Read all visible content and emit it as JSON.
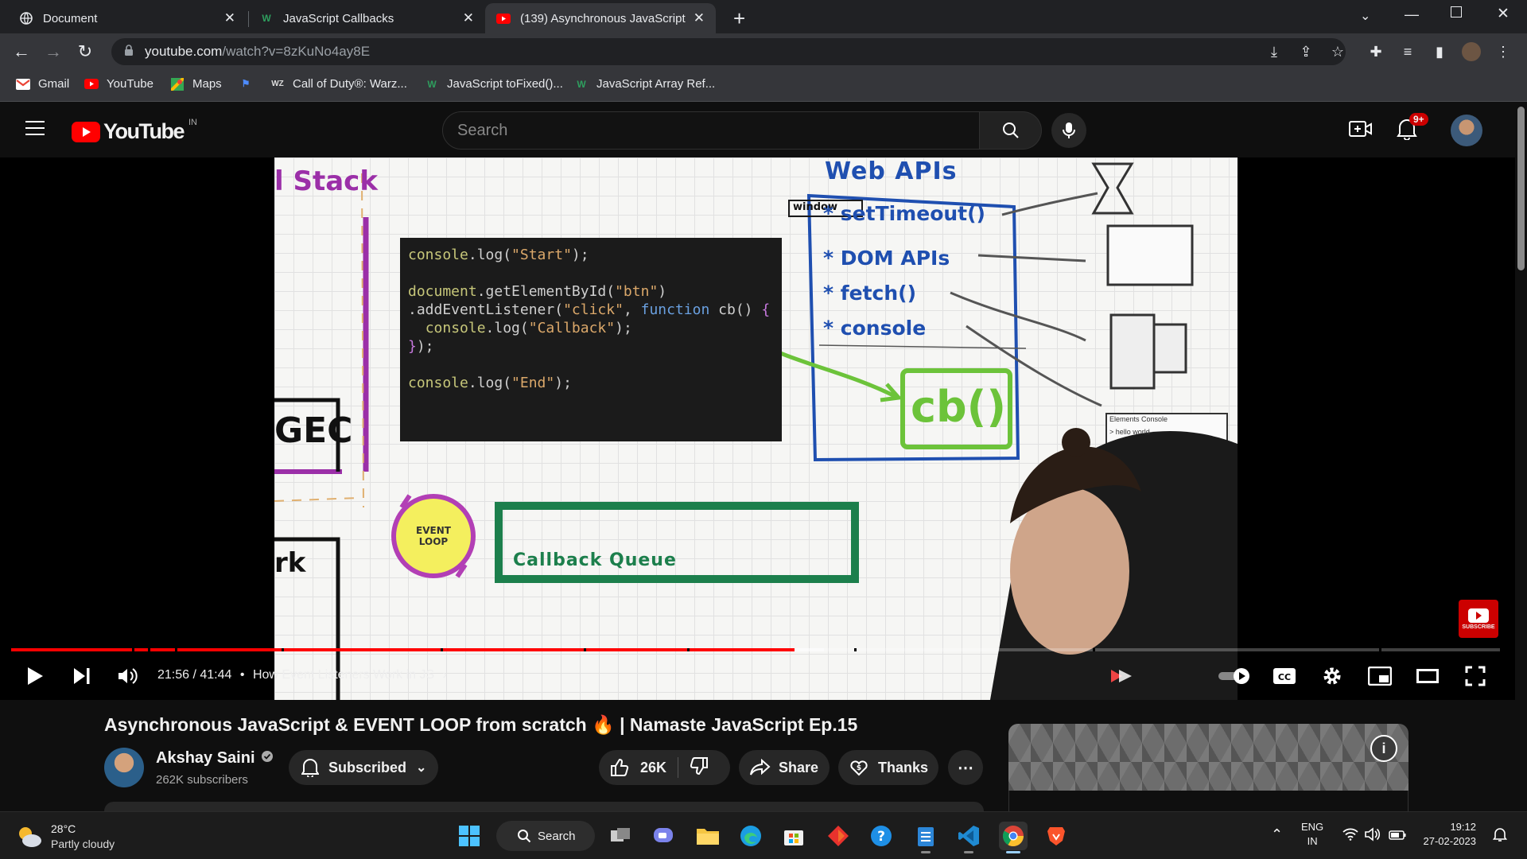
{
  "browser": {
    "tabs": [
      {
        "title": "Document",
        "active": false
      },
      {
        "title": "JavaScript Callbacks",
        "active": false
      },
      {
        "title": "(139) Asynchronous JavaScript &",
        "active": true
      }
    ],
    "url_host": "youtube.com",
    "url_path": "/watch?v=8zKuNo4ay8E",
    "bookmarks": [
      "Gmail",
      "YouTube",
      "Maps",
      "Call of Duty®: Warz...",
      "JavaScript toFixed()...",
      "JavaScript Array Ref..."
    ]
  },
  "youtube": {
    "logo_text": "YouTube",
    "region": "IN",
    "search_placeholder": "Search",
    "notifications": "9+"
  },
  "video_frame": {
    "call_stack_label": "l Stack",
    "gec_label": "GEC",
    "task_label": "rk",
    "code_lines": [
      "console.log(\"Start\");",
      "",
      "document.getElementById(\"btn\")",
      ".addEventListener(\"click\", function cb() {",
      "  console.log(\"Callback\");",
      "});",
      "",
      "console.log(\"End\");"
    ],
    "web_apis_title": "Web APIs",
    "window_label": "window",
    "web_apis": [
      "* setTimeout()",
      "* DOM APIs",
      "* fetch()",
      "* console"
    ],
    "cb_label": "cb()",
    "event_loop_label": "EVENT LOOP",
    "callback_queue_label": "Callback Queue",
    "devtools_tabs": "Elements   Console",
    "devtools_output": "> hello world",
    "subscribe_watermark": "SUBSCRIBE"
  },
  "player": {
    "time": "21:56 / 41:44",
    "chapter": "How Event Listeners Work in JS",
    "progress_fraction": 0.526
  },
  "video": {
    "title": "Asynchronous JavaScript & EVENT LOOP from scratch 🔥 | Namaste JavaScript Ep.15",
    "channel": "Akshay Saini",
    "subscribers": "262K subscribers",
    "subscribe_label": "Subscribed",
    "likes": "26K",
    "share_label": "Share",
    "thanks_label": "Thanks"
  },
  "taskbar": {
    "weather_temp": "28°C",
    "weather_text": "Partly cloudy",
    "search_label": "Search",
    "lang": "ENG",
    "region": "IN",
    "time": "19:12",
    "date": "27-02-2023"
  },
  "colors": {
    "accent_red": "#ff0000",
    "chrome_dark": "#202124",
    "youtube_bg": "#0f0f0f"
  }
}
